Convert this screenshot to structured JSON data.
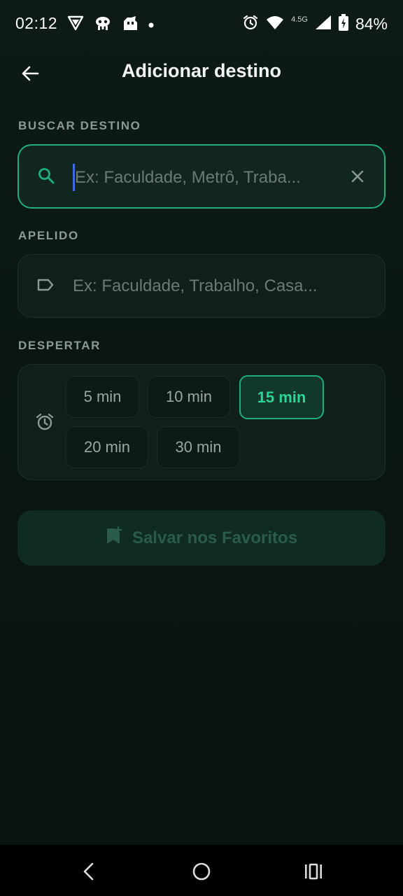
{
  "status_bar": {
    "time": "02:12",
    "network": "4.5G",
    "battery": "84%"
  },
  "header": {
    "title": "Adicionar destino"
  },
  "search": {
    "label": "BUSCAR DESTINO",
    "placeholder": "Ex: Faculdade, Metrô, Traba...",
    "value": ""
  },
  "nickname": {
    "label": "APELIDO",
    "placeholder": "Ex: Faculdade, Trabalho, Casa...",
    "value": ""
  },
  "wake": {
    "label": "DESPERTAR",
    "options": [
      "5 min",
      "10 min",
      "15 min",
      "20 min",
      "30 min"
    ],
    "selected": "15 min"
  },
  "save_button": {
    "label": "Salvar nos Favoritos"
  },
  "colors": {
    "accent": "#1fae7f",
    "accent_text": "#2bd497",
    "background": "#0a1512"
  },
  "icons": {
    "back": "arrow-left-icon",
    "search": "search-icon",
    "clear": "close-icon",
    "tag": "label-tag-icon",
    "alarm": "alarm-clock-icon",
    "save": "bookmark-add-icon"
  }
}
